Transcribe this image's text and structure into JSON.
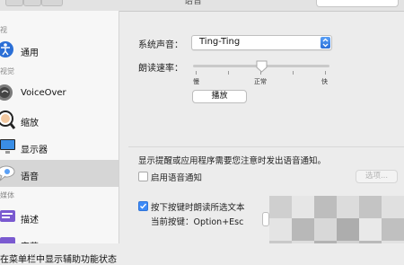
{
  "window": {
    "title": "语音"
  },
  "sidebar": {
    "sections": [
      "视",
      "视觉"
    ],
    "sections_full": {
      "top": "视",
      "vision": "视觉",
      "media": "媒体"
    },
    "items": [
      {
        "label": "通用",
        "icon": "accessibility-icon"
      },
      {
        "label": "VoiceOver",
        "icon": "voiceover-icon"
      },
      {
        "label": "缩放",
        "icon": "zoom-icon"
      },
      {
        "label": "显示器",
        "icon": "display-icon"
      },
      {
        "label": "语音",
        "icon": "speech-icon",
        "selected": true
      },
      {
        "label": "描述",
        "icon": "descriptions-icon"
      },
      {
        "label": "字幕",
        "icon": "captions-icon"
      }
    ]
  },
  "main": {
    "system_voice_label": "系统声音：",
    "system_voice_value": "Ting-Ting",
    "speaking_rate_label": "朗读速率：",
    "rate_slow": "慢",
    "rate_normal": "正常",
    "rate_fast": "快",
    "speaking_rate_level": 0.5,
    "play_button": "播放",
    "announce_text": "显示提醒或应用程序需要您注意时发出语音通知。",
    "enable_announcements_label": "启用语音通知",
    "enable_announcements_checked": false,
    "options_button": "选项...",
    "speak_selected_label": "按下按键时朗读所选文本",
    "speak_selected_checked": true,
    "current_key_label": "当前按键：Option+Esc"
  },
  "status": {
    "text": "在菜单栏中显示辅助功能状态"
  },
  "colors": {
    "accent": "#3d8af7",
    "selection": "#d6d6d6"
  }
}
